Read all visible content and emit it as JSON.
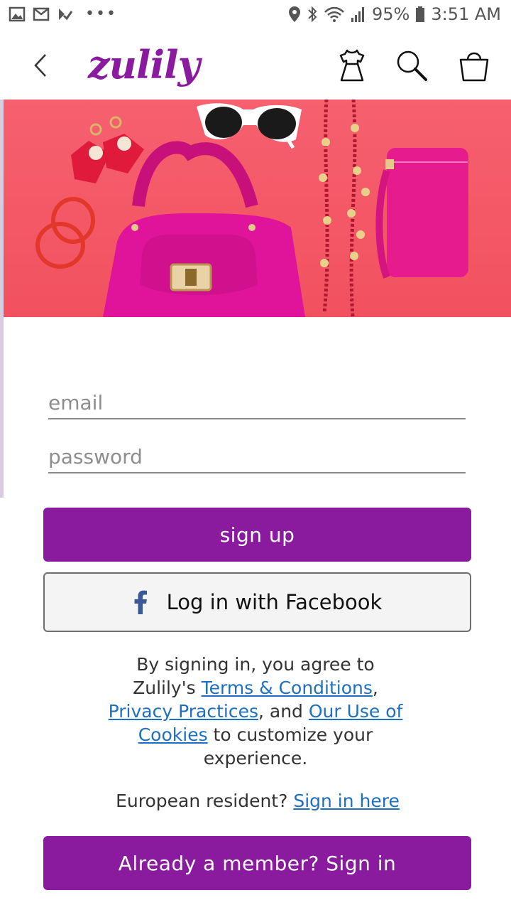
{
  "status_bar": {
    "dots": "•••",
    "battery": "95%",
    "time": "3:51 AM"
  },
  "header": {
    "logo_text": "zulily",
    "icons": [
      "back-icon",
      "dress-icon",
      "search-icon",
      "shopping-bag-icon"
    ]
  },
  "form": {
    "email_placeholder": "email",
    "password_placeholder": "password",
    "signup_label": "sign up",
    "facebook_label": "Log in with Facebook"
  },
  "legal": {
    "part1": "By signing in, you agree to Zulily's ",
    "terms_link": "Terms & Conditions",
    "comma": ", ",
    "privacy_link": "Privacy Practices",
    "and": ", and ",
    "cookies_link": "Our Use of Cookies",
    "part2": " to customize your experience."
  },
  "eu": {
    "text": "European resident? ",
    "link": "Sign in here"
  },
  "signin_label": "Already a member? Sign in",
  "colors": {
    "brand_purple": "#8a1a9e",
    "link_blue": "#1f6fc0",
    "hero_pink": "#f6606f"
  }
}
